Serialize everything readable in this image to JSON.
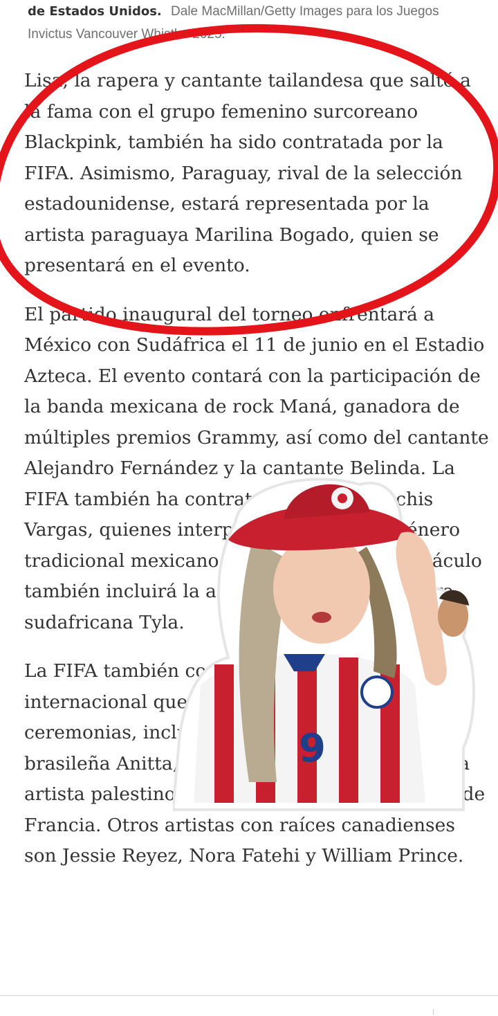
{
  "caption": {
    "lead": "de Estados Unidos.",
    "credit": "Dale MacMillan/Getty Images para los Juegos Invictus Vancouver Whistler 2025."
  },
  "article": {
    "paragraphs": [
      "Lisa, la rapera y cantante tailandesa que saltó a la fama con el grupo femenino surcoreano Blackpink, también ha sido contratada por la FIFA. Asimismo, Paraguay, rival de la selección estadounidense, estará representada por la artista paraguaya Marilina Bogado, quien se presentará en el evento.",
      "El partido inaugural del torneo enfrentará a México con Sudáfrica el 11 de junio en el Estadio Azteca. El evento contará con la participación de la banda mexicana de rock Maná, ganadora de múltiples premios Grammy, así como del cantante Alejandro Fernández y la cantante Belinda. La FIFA también ha contratado a los Mariachis Vargas, quienes interpretan música del género tradicional mexicano de mariachi. El espectáculo también incluirá la actuación de la cantautora sudafricana Tyla.",
      "La FIFA también contará con talento internacional que se presentará en las ceremonias, incluidos el colombiano J Balvin, la brasileña Anitta, el venezolano Danny Ocean, la artista palestino-chilena Elyanna y Vegedream de Francia. Otros artistas con raíces canadienses son Jessie Reyez, Nora Fatehi y William Prince."
    ]
  },
  "sticker": {
    "jersey_number": "9",
    "colors": {
      "red": "#c8202f",
      "white": "#f4f4f4",
      "blue": "#1f3f8a",
      "hair": "#b9ab92"
    }
  },
  "annotation": {
    "color": "#e4141b"
  }
}
